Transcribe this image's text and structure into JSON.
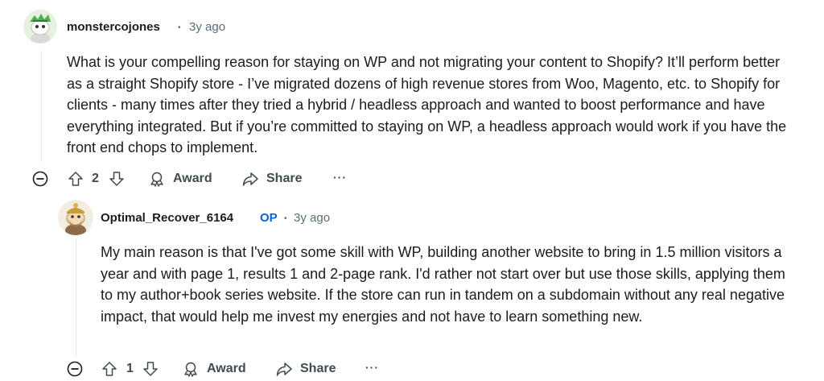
{
  "comments": [
    {
      "username": "monstercojones",
      "is_op": false,
      "age": "3y ago",
      "body": "What is your compelling reason for staying on WP and not migrating your content to Shopify? It’ll perform better as a straight Shopify store - I’ve migrated dozens of high revenue stores from Woo, Magento, etc. to Shopify for clients - many times after they tried a hybrid / headless approach and wanted to boost performance and have everything integrated. But if you’re committed to staying on WP, a headless approach would work if you have the front end chops to implement.",
      "score": "2",
      "award_label": "Award",
      "share_label": "Share",
      "more_label": "···",
      "avatar_icon": "snoo-avatar-green-hair-icon"
    },
    {
      "username": "Optimal_Recover_6164",
      "is_op": true,
      "op_label": "OP",
      "age": "3y ago",
      "body": "My main reason is that I've got some skill with WP, building another website to bring in 1.5 million visitors a year and with page 1, results 1 and 2-page rank. I'd rather not start over but use those skills, applying them to my author+book series website. If the store can run in tandem on a subdomain without any real negative impact, that would help me invest my energies and not have to learn something new.",
      "score": "1",
      "award_label": "Award",
      "share_label": "Share",
      "more_label": "···",
      "avatar_icon": "snoo-avatar-bearded-icon"
    }
  ],
  "separator": "•",
  "colors": {
    "text": "#1c1c1c",
    "meta": "#576f76",
    "op": "#0a61d6",
    "action": "#3e4b50",
    "thread": "#e5ebee"
  }
}
